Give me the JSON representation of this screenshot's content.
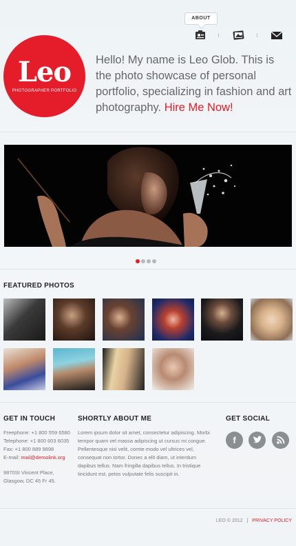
{
  "nav": {
    "about_label": "ABOUT",
    "icons": [
      "id-card-icon",
      "photo-album-icon",
      "envelope-icon"
    ]
  },
  "logo": {
    "title": "Leo",
    "subtitle": "PHOTOGRAPHER PORTFOLIO",
    "color": "#e51c2a"
  },
  "intro": {
    "text": "Hello! My name is Leo Glob. This is the photo showcase of personal portfolio, specializing in fashion and art photography.",
    "cta": "Hire Me Now!"
  },
  "slider": {
    "active_index": 0,
    "dot_count": 4
  },
  "featured": {
    "title": "FEATURED PHOTOS",
    "photos": [
      {
        "name": "photo-1"
      },
      {
        "name": "photo-2"
      },
      {
        "name": "photo-3"
      },
      {
        "name": "photo-4"
      },
      {
        "name": "photo-5"
      },
      {
        "name": "photo-6"
      },
      {
        "name": "photo-7"
      },
      {
        "name": "photo-8"
      },
      {
        "name": "photo-9"
      },
      {
        "name": "photo-10"
      }
    ]
  },
  "contact": {
    "title": "GET IN TOUCH",
    "freephone": "Freephone: +1 800 559 6580",
    "telephone": "Telephone: +1 800 603 6035",
    "fax": "Fax: +1 800 889 9898",
    "email_label": "E-mail: ",
    "email": "mail@demolink.org",
    "address_line1": "9870St Vincent Place,",
    "address_line2": "Glasgow, DC 45 Fr 45."
  },
  "about": {
    "title": "SHORTLY ABOUT ME",
    "text": "Lorem ipsum dolor sit amet, consectetur adipiscing. Morbi tempor quam vel massa adipiscing ut cursus mi congue. Pellentesque nisi velit, comte modo vel ultrices vel, consequat non tortor. Donec a elit diam, ut interdum dapibus tellus. Nam fringilla dapibus tellus. In tristique tincidunt est, petos vulputate felis suscipit in."
  },
  "social": {
    "title": "GET SOCIAL",
    "items": [
      {
        "icon": "facebook-icon",
        "glyph": "f"
      },
      {
        "icon": "twitter-icon",
        "glyph": "t"
      },
      {
        "icon": "rss-icon",
        "glyph": "◔"
      }
    ]
  },
  "footer": {
    "copyright": "LEO © 2012",
    "separator": "|",
    "privacy": "PRIVACY POLICY"
  }
}
